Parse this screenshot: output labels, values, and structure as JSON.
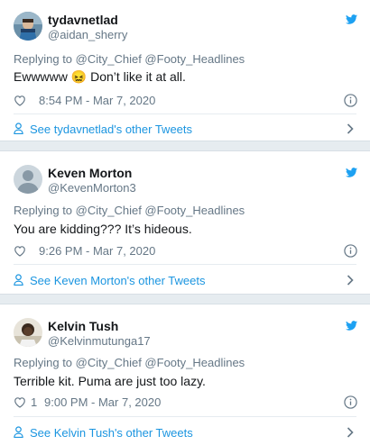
{
  "tweets": [
    {
      "name": "tydavnetlad",
      "handle": "@aidan_sherry",
      "reply": "Replying to @City_Chief @Footy_Headlines",
      "text": "Ewwwww 😖 Don’t like it at all.",
      "likes": "",
      "time": "8:54 PM - Mar 7, 2020",
      "other": "See tydavnetlad's other Tweets",
      "avatar": "avatar-blue-scarf"
    },
    {
      "name": "Keven Morton",
      "handle": "@KevenMorton3",
      "reply": "Replying to @City_Chief @Footy_Headlines",
      "text": "You are kidding??? It’s hideous.",
      "likes": "",
      "time": "9:26 PM - Mar 7, 2020",
      "other": "See Keven Morton's other Tweets",
      "avatar": "default-avatar"
    },
    {
      "name": "Kelvin Tush",
      "handle": "@Kelvinmutunga17",
      "reply": "Replying to @City_Chief @Footy_Headlines",
      "text": "Terrible kit. Puma are just too lazy.",
      "likes": "1",
      "time": "9:00 PM - Mar 7, 2020",
      "other": "See Kelvin Tush's other Tweets",
      "avatar": "avatar-photo"
    }
  ],
  "colors": {
    "twitter_blue": "#1da1f2",
    "link_blue": "#1b95e0",
    "muted": "#657786",
    "separator": "#e6ecf0"
  }
}
